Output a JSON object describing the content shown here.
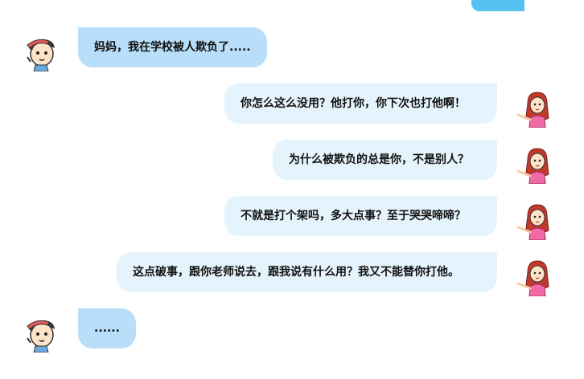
{
  "messages": [
    {
      "side": "left",
      "speaker": "child",
      "text": "妈妈，我在学校被人欺负了....."
    },
    {
      "side": "right",
      "speaker": "mother",
      "text": "你怎么这么没用？他打你，你下次也打他啊！"
    },
    {
      "side": "right",
      "speaker": "mother",
      "text": "为什么被欺负的总是你，不是别人？"
    },
    {
      "side": "right",
      "speaker": "mother",
      "text": "不就是打个架吗，多大点事？至于哭哭啼啼？"
    },
    {
      "side": "right",
      "speaker": "mother",
      "text": "这点破事，跟你老师说去，跟我说有什么用？我又不能替你打他。"
    },
    {
      "side": "left",
      "speaker": "child",
      "text": "......"
    }
  ],
  "colors": {
    "left_bubble": "#b8def9",
    "right_bubble": "#e5f3fc",
    "accent": "#56c1f0"
  },
  "icons": {
    "child_avatar": "boy-with-cap-icon",
    "mother_avatar": "woman-red-hair-icon"
  }
}
